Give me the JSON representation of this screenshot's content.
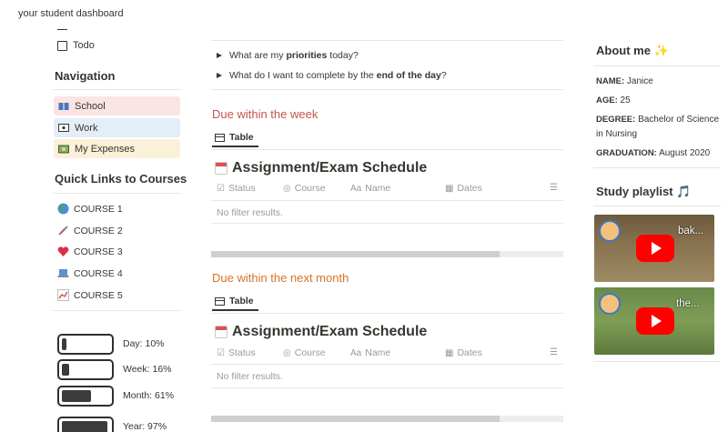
{
  "page": {
    "title": "your student dashboard"
  },
  "left": {
    "todo_label": "Todo",
    "navigation": {
      "heading": "Navigation",
      "items": [
        {
          "label": "School",
          "icon": "book-icon"
        },
        {
          "label": "Work",
          "icon": "monitor-icon"
        },
        {
          "label": "My Expenses",
          "icon": "money-icon"
        }
      ]
    },
    "quick_links": {
      "heading": "Quick Links to Courses",
      "courses": [
        {
          "label": "COURSE 1",
          "icon": "globe-icon"
        },
        {
          "label": "COURSE 2",
          "icon": "syringe-icon"
        },
        {
          "label": "COURSE 3",
          "icon": "heart-icon"
        },
        {
          "label": "COURSE 4",
          "icon": "laptop-icon"
        },
        {
          "label": "COURSE 5",
          "icon": "chart-icon"
        }
      ]
    },
    "progress": [
      {
        "label": "Day: 10%",
        "value": 0.1
      },
      {
        "label": "Week: 16%",
        "value": 0.16
      },
      {
        "label": "Month: 61%",
        "value": 0.61
      },
      {
        "label": "Year: 97%",
        "value": 0.97
      }
    ]
  },
  "main": {
    "questions": [
      {
        "pre": "What are my ",
        "bold": "priorities",
        "post": " today?"
      },
      {
        "pre": "What do I want to complete by the ",
        "bold": "end of the day",
        "post": "?"
      }
    ],
    "sections": [
      {
        "heading": "Due within the week",
        "tab": "Table",
        "db_title": "Assignment/Exam Schedule",
        "columns": [
          "Status",
          "Course",
          "Name",
          "Dates"
        ],
        "empty_text": "No filter results."
      },
      {
        "heading": "Due within the next month",
        "tab": "Table",
        "db_title": "Assignment/Exam Schedule",
        "columns": [
          "Status",
          "Course",
          "Name",
          "Dates"
        ],
        "empty_text": "No filter results."
      }
    ]
  },
  "right": {
    "about": {
      "heading": "About me ✨",
      "name_label": "NAME:",
      "name": "Janice",
      "age_label": "AGE:",
      "age": "25",
      "degree_label": "DEGREE:",
      "degree": "Bachelor of Science in Nursing",
      "graduation_label": "GRADUATION:",
      "graduation": "August 2020"
    },
    "playlist": {
      "heading": "Study playlist 🎵",
      "videos": [
        {
          "title": "bak..."
        },
        {
          "title": "the..."
        }
      ]
    }
  }
}
